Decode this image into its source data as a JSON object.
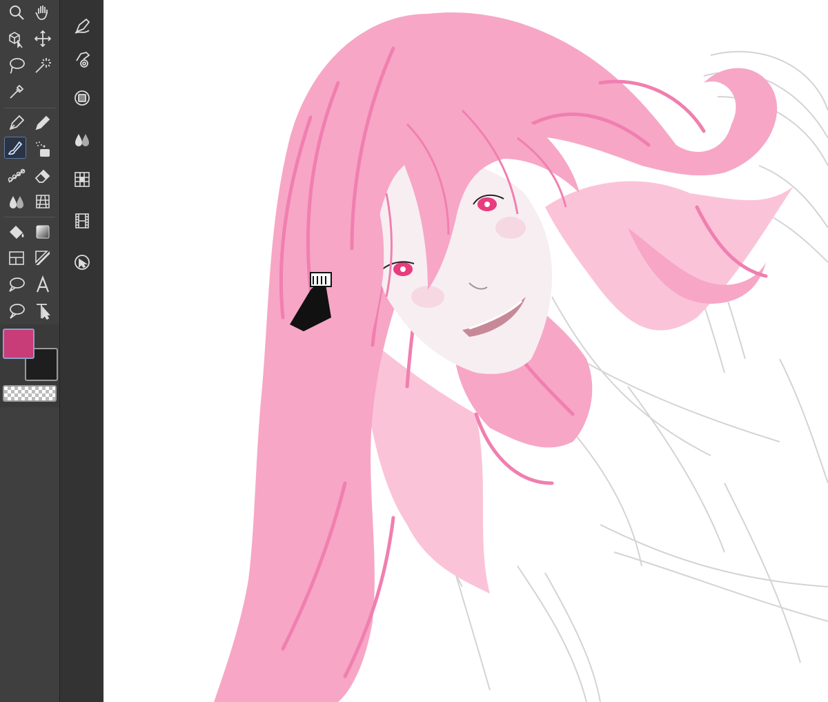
{
  "app": {
    "tools": [
      {
        "name": "zoom-icon"
      },
      {
        "name": "hand-icon"
      },
      {
        "name": "object-select-icon"
      },
      {
        "name": "move-layer-icon"
      },
      {
        "name": "lasso-selection-icon"
      },
      {
        "name": "magic-wand-icon"
      },
      {
        "name": "eyedropper-icon"
      },
      {
        "name": "pen-icon"
      },
      {
        "name": "pencil-icon"
      },
      {
        "name": "brush-icon"
      },
      {
        "name": "airbrush-icon"
      },
      {
        "name": "decoration-icon"
      },
      {
        "name": "eraser-icon"
      },
      {
        "name": "blend-icon"
      },
      {
        "name": "figure-icon"
      },
      {
        "name": "fill-icon"
      },
      {
        "name": "gradient-icon"
      },
      {
        "name": "frame-border-icon"
      },
      {
        "name": "ruler-icon"
      },
      {
        "name": "balloon-icon"
      },
      {
        "name": "text-icon"
      },
      {
        "name": "speech-balloon-icon"
      },
      {
        "name": "correct-line-icon"
      }
    ],
    "active_tool": "brush-icon",
    "colors": {
      "main": "#c83c78",
      "sub": "#1e1e1e",
      "transparent_label": ""
    },
    "subtools": [
      {
        "name": "vector-pen-icon"
      },
      {
        "name": "lasso-target-icon"
      },
      {
        "name": "layer-property-icon"
      },
      {
        "name": "blend-drops-icon"
      },
      {
        "name": "grid-icon"
      },
      {
        "name": "film-icon"
      },
      {
        "name": "cursor-icon"
      }
    ],
    "canvas": {
      "accent_hair": "#f7a6c6",
      "accent_hair_dark": "#f07fb0",
      "skin": "#f7eef2",
      "eye": "#e83c7e",
      "sketch": "#c8c8c8"
    }
  }
}
